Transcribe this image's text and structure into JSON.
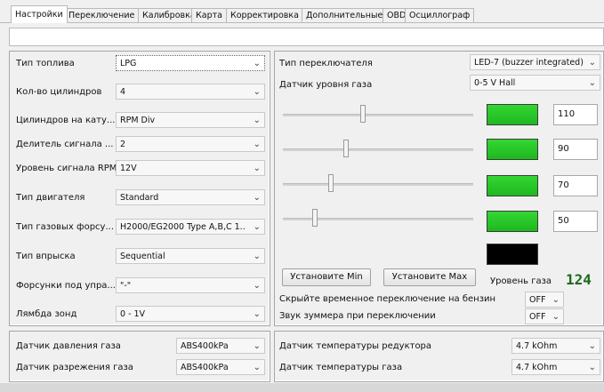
{
  "tabs": [
    "Настройки",
    "Переключение",
    "Калибровка",
    "Карта",
    "Корректировка",
    "Дополнительные",
    "OBD",
    "Осциллограф"
  ],
  "left": {
    "rows": [
      {
        "label": "Тип топлива",
        "value": "LPG"
      },
      {
        "label": "Кол-во цилиндров",
        "value": "4"
      },
      {
        "label": "Цилиндров на кату...",
        "value": "RPM Div"
      },
      {
        "label": "Делитель сигнала ...",
        "value": "2"
      },
      {
        "label": "Уровень сигнала RPM",
        "value": "12V"
      },
      {
        "label": "Тип двигателя",
        "value": "Standard"
      },
      {
        "label": "Тип газовых форсу...",
        "value": "H2000/EG2000 Type A,B,C 1...."
      },
      {
        "label": "Тип впрыска",
        "value": "Sequential"
      },
      {
        "label": "Форсунки под упра...",
        "value": "\"-\""
      },
      {
        "label": "Лямбда зонд",
        "value": "0 - 1V"
      }
    ]
  },
  "right": {
    "switch_type": {
      "label": "Тип переключателя",
      "value": "LED-7 (buzzer integrated)"
    },
    "gas_sensor": {
      "label": "Датчик уровня газа",
      "value": "0-5 V Hall"
    },
    "levels": [
      {
        "value": "110",
        "slider": 0.42,
        "state": "on"
      },
      {
        "value": "90",
        "slider": 0.33,
        "state": "on"
      },
      {
        "value": "70",
        "slider": 0.25,
        "state": "on"
      },
      {
        "value": "50",
        "slider": 0.17,
        "state": "on"
      },
      {
        "value": "",
        "slider": null,
        "state": "off"
      }
    ],
    "btn_min": "Установите Min",
    "btn_max": "Установите Max",
    "gas_level_label": "Уровень газа",
    "gas_level_value": "124",
    "hide_switch": {
      "label": "Скрыйте временное переключение на бензин",
      "value": "OFF"
    },
    "buzzer": {
      "label": "Звук зуммера при переключении",
      "value": "OFF"
    }
  },
  "bottom_left": [
    {
      "label": "Датчик давления газа",
      "value": "ABS400kPa"
    },
    {
      "label": "Датчик разрежения газа",
      "value": "ABS400kPa"
    }
  ],
  "bottom_right": [
    {
      "label": "Датчик температуры редуктора",
      "value": "4.7 kOhm"
    },
    {
      "label": "Датчик температуры газа",
      "value": "4.7 kOhm"
    }
  ],
  "colors": {
    "bar_on": "#22c322",
    "bar_off": "#000000",
    "level_value": "#1a6b1a"
  }
}
